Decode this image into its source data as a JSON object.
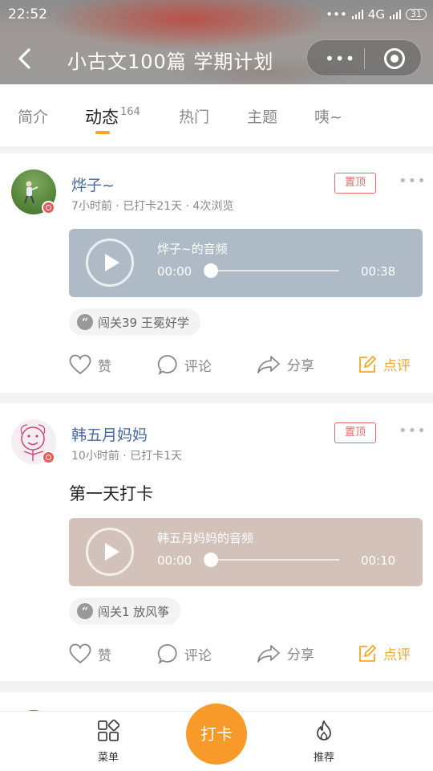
{
  "status_bar": {
    "time": "22:52",
    "network": "4G",
    "battery": "31"
  },
  "nav": {
    "title": "小古文100篇 学期计划",
    "menu_dots": "•••"
  },
  "tabs": [
    {
      "label": "简介"
    },
    {
      "label": "动态",
      "count": "164"
    },
    {
      "label": "热门"
    },
    {
      "label": "主题"
    },
    {
      "label": "咦~"
    }
  ],
  "posts": [
    {
      "user": "烨子~",
      "meta": "7小时前 · 已打卡21天 · 4次浏览",
      "pin_label": "置顶",
      "more": "•••",
      "text": "",
      "audio": {
        "title": "烨子~的音频",
        "current": "00:00",
        "duration": "00:38",
        "color": "#aebbc6"
      },
      "tag": {
        "icon": "quote-icon",
        "text": "闯关39 王冕好学"
      },
      "actions": {
        "like": "赞",
        "comment": "评论",
        "share": "分享",
        "review": "点评"
      }
    },
    {
      "user": "韩五月妈妈",
      "meta": "10小时前 · 已打卡1天",
      "pin_label": "置顶",
      "more": "•••",
      "text": "第一天打卡",
      "audio": {
        "title": "韩五月妈妈的音频",
        "current": "00:00",
        "duration": "00:10",
        "color": "#d2c2ba"
      },
      "tag": {
        "icon": "quote-icon",
        "text": "闯关1 放风筝"
      },
      "actions": {
        "like": "赞",
        "comment": "评论",
        "share": "分享",
        "review": "点评"
      }
    }
  ],
  "bottom_bar": {
    "menu_label": "菜单",
    "checkin_label": "打卡",
    "recommend_label": "推荐"
  },
  "colors": {
    "accent": "#f5a623",
    "pin": "#e06b6b",
    "name": "#4a6a9c"
  }
}
